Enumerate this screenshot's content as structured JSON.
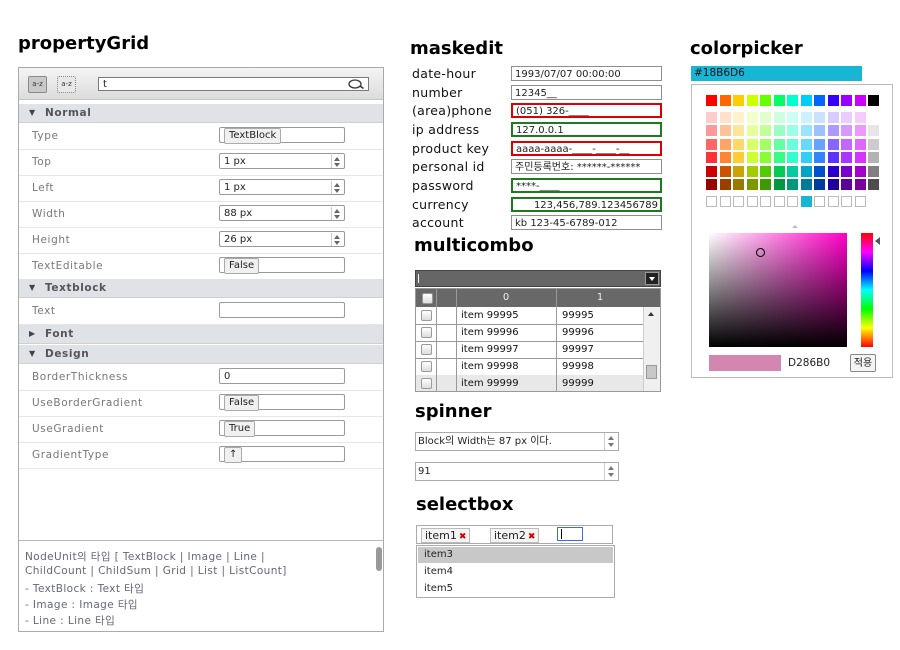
{
  "titles": {
    "property_grid": "propertyGrid",
    "maskedit": "maskedit",
    "colorpicker": "colorpicker",
    "multicombo": "multicombo",
    "spinner": "spinner",
    "selectbox": "selectbox"
  },
  "property_grid": {
    "toolbar": {
      "sort_category_icon": "a-z",
      "sort_alpha_icon": "a-z",
      "search_value": "t"
    },
    "categories": {
      "normal": "Normal",
      "textblock": "Textblock",
      "font": "Font",
      "design": "Design"
    },
    "rows": {
      "type": {
        "label": "Type",
        "value": "TextBlock"
      },
      "top": {
        "label": "Top",
        "value": "1 px"
      },
      "left": {
        "label": "Left",
        "value": "1 px"
      },
      "width": {
        "label": "Width",
        "value": "88 px"
      },
      "height": {
        "label": "Height",
        "value": "26 px"
      },
      "text_editable": {
        "label": "TextEditable",
        "value": "False"
      },
      "text": {
        "label": "Text",
        "value": ""
      },
      "border_thickness": {
        "label": "BorderThickness",
        "value": "0"
      },
      "use_border_gradient": {
        "label": "UseBorderGradient",
        "value": "False"
      },
      "use_gradient": {
        "label": "UseGradient",
        "value": "True"
      },
      "gradient_type": {
        "label": "GradientType",
        "value": "↑"
      }
    },
    "description": [
      "NodeUnit의 타입 [ TextBlock | Image | Line |",
      "ChildCount | ChildSum | Grid | List | ListCount]",
      "- TextBlock : Text 타입",
      "- Image : Image 타입",
      "- Line : Line 타입"
    ]
  },
  "maskedit": {
    "fields": [
      {
        "label": "date-hour",
        "value": "1993/07/07  00:00:00"
      },
      {
        "label": "number",
        "value": "12345__"
      },
      {
        "label": "(area)phone",
        "value": "(051) 326-____"
      },
      {
        "label": "ip address",
        "value": "127.0.0.1"
      },
      {
        "label": "product key",
        "value": "aaaa-aaaa-____-____-__"
      },
      {
        "label": "personal id",
        "value": "주민등록번호: ******-******"
      },
      {
        "label": "password",
        "value": "****-____"
      },
      {
        "label": "currency",
        "value": "123,456,789.123456789"
      },
      {
        "label": "account",
        "value": "kb 123-45-6789-012"
      }
    ]
  },
  "multicombo": {
    "input_value": "",
    "headers": [
      "0",
      "1"
    ],
    "rows": [
      [
        "item 99995",
        "99995"
      ],
      [
        "item 99996",
        "99996"
      ],
      [
        "item 99997",
        "99997"
      ],
      [
        "item 99998",
        "99998"
      ],
      [
        "item 99999",
        "99999"
      ]
    ]
  },
  "spinner": {
    "text_spinner": "Block의 Width는  87 px 이다.",
    "number_spinner": "91"
  },
  "selectbox": {
    "selected_tags": [
      "item1",
      "item2"
    ],
    "tag_remove_glyph": "✖",
    "options": [
      "item3",
      "item4",
      "item5"
    ],
    "highlighted_option": "item3"
  },
  "colorpicker": {
    "hex_input": "#18B6D6",
    "hex_input_color": "#18b6d6",
    "preview_hex": "D286B0",
    "preview_color": "#d286b0",
    "apply_label": "적용",
    "palette_rows": [
      [
        "#ff0000",
        "#ff6600",
        "#ffcc00",
        "#ccff00",
        "#66ff00",
        "#00ff66",
        "#00ffcc",
        "#00ccff",
        "#0066ff",
        "#3300ff",
        "#9900ff",
        "#cc00ff",
        "#000000"
      ],
      [
        "#ffcccc",
        "#ffe0cc",
        "#fff2cc",
        "#f2ffcc",
        "#e0ffcc",
        "#ccffe0",
        "#ccfff2",
        "#ccf2ff",
        "#cce0ff",
        "#d6ccff",
        "#ebccff",
        "#f5ccff",
        "#ffffff"
      ],
      [
        "#ff9999",
        "#ffc299",
        "#ffe599",
        "#e5ff99",
        "#c2ff99",
        "#99ffc2",
        "#99ffe5",
        "#99e5ff",
        "#99c2ff",
        "#ad99ff",
        "#d699ff",
        "#eb99ff",
        "#e6e6e6"
      ],
      [
        "#ff6666",
        "#ffa366",
        "#ffd966",
        "#d9ff66",
        "#a3ff66",
        "#66ffa3",
        "#66ffd9",
        "#66d9ff",
        "#66a3ff",
        "#8566ff",
        "#c266ff",
        "#e066ff",
        "#cccccc"
      ],
      [
        "#ff3333",
        "#ff8533",
        "#ffcc33",
        "#ccff33",
        "#85ff33",
        "#33ff85",
        "#33ffcc",
        "#33ccff",
        "#3385ff",
        "#5c33ff",
        "#ad33ff",
        "#d633ff",
        "#b3b3b3"
      ],
      [
        "#cc0000",
        "#cc5200",
        "#cca300",
        "#a3cc00",
        "#52cc00",
        "#00cc52",
        "#00cca3",
        "#00a3cc",
        "#0052cc",
        "#2900cc",
        "#7a00cc",
        "#a300cc",
        "#808080"
      ],
      [
        "#990000",
        "#993d00",
        "#997a00",
        "#7a9900",
        "#3d9900",
        "#00993d",
        "#00997a",
        "#007a99",
        "#003d99",
        "#1f0099",
        "#5c0099",
        "#7a0099",
        "#4d4d4d"
      ]
    ],
    "recent_colors": [
      "",
      "",
      "",
      "",
      "",
      "",
      "",
      "#18b6d6",
      "",
      "",
      "",
      ""
    ]
  }
}
